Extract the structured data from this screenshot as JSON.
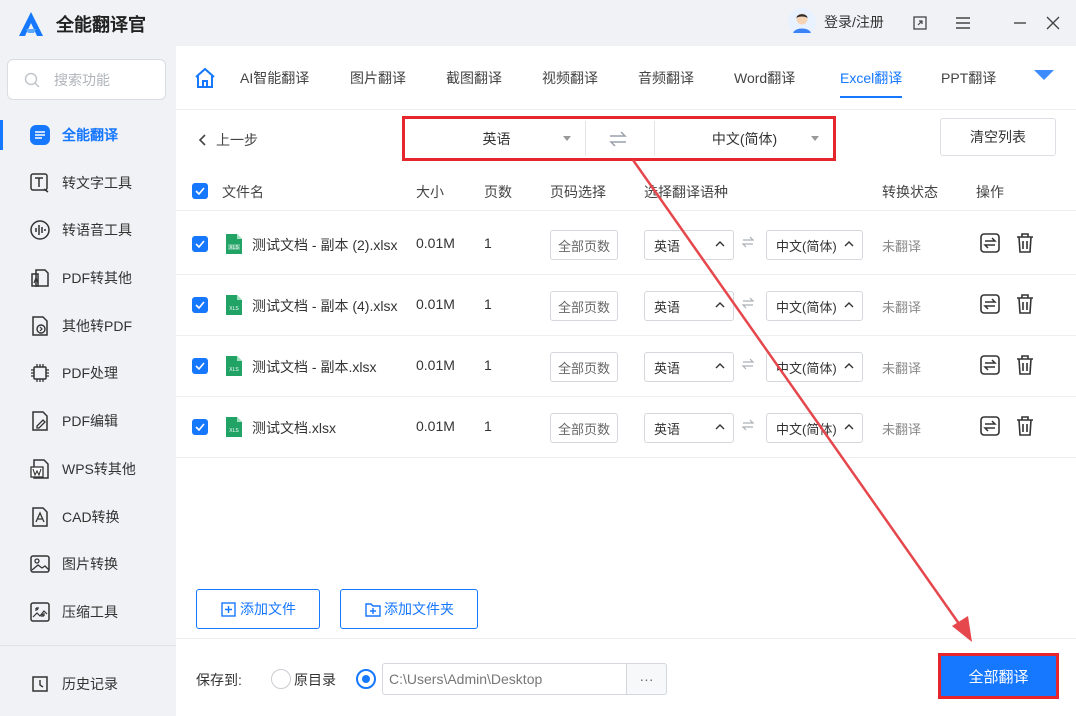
{
  "app": {
    "name": "全能翻译官",
    "brand_color": "#1677ff",
    "highlight_color": "#e5262c"
  },
  "search": {
    "placeholder": "搜索功能"
  },
  "sidebar": {
    "items": [
      {
        "label": "全能翻译",
        "icon": "translate-icon",
        "active": true
      },
      {
        "label": "转文字工具",
        "icon": "text-convert-icon"
      },
      {
        "label": "转语音工具",
        "icon": "audio-wave-icon"
      },
      {
        "label": "PDF转其他",
        "icon": "pdf-convert-icon"
      },
      {
        "label": "其他转PDF",
        "icon": "to-pdf-icon"
      },
      {
        "label": "PDF处理",
        "icon": "chip-icon"
      },
      {
        "label": "PDF编辑",
        "icon": "pdf-edit-icon"
      },
      {
        "label": "WPS转其他",
        "icon": "wps-icon"
      },
      {
        "label": "CAD转换",
        "icon": "cad-icon"
      },
      {
        "label": "图片转换",
        "icon": "image-icon"
      },
      {
        "label": "压缩工具",
        "icon": "compress-icon"
      }
    ],
    "history": "历史记录"
  },
  "header": {
    "login": "登录/注册"
  },
  "tabs": [
    "AI智能翻译",
    "图片翻译",
    "截图翻译",
    "视频翻译",
    "音频翻译",
    "Word翻译",
    "Excel翻译",
    "PPT翻译"
  ],
  "active_tab": "Excel翻译",
  "toolbar": {
    "back": "上一步",
    "source_lang": "英语",
    "target_lang": "中文(简体)",
    "clear": "清空列表"
  },
  "table": {
    "headers": {
      "name": "文件名",
      "size": "大小",
      "pages": "页数",
      "page_select": "页码选择",
      "lang_select": "选择翻译语种",
      "status": "转换状态",
      "action": "操作"
    },
    "rows": [
      {
        "name": "测试文档 - 副本 (2).xlsx",
        "size": "0.01M",
        "pages": "1",
        "page_select": "全部页数",
        "src": "英语",
        "dst": "中文(简体)",
        "status": "未翻译"
      },
      {
        "name": "测试文档 - 副本 (4).xlsx",
        "size": "0.01M",
        "pages": "1",
        "page_select": "全部页数",
        "src": "英语",
        "dst": "中文(简体)",
        "status": "未翻译"
      },
      {
        "name": "测试文档 - 副本.xlsx",
        "size": "0.01M",
        "pages": "1",
        "page_select": "全部页数",
        "src": "英语",
        "dst": "中文(简体)",
        "status": "未翻译"
      },
      {
        "name": "测试文档.xlsx",
        "size": "0.01M",
        "pages": "1",
        "page_select": "全部页数",
        "src": "英语",
        "dst": "中文(简体)",
        "status": "未翻译"
      }
    ],
    "file_icon_label": "XLS"
  },
  "buttons": {
    "add_file": "添加文件",
    "add_folder": "添加文件夹",
    "translate_all": "全部翻译"
  },
  "save": {
    "label": "保存到:",
    "original": "原目录",
    "path": "C:\\Users\\Admin\\Desktop",
    "more": "···"
  }
}
